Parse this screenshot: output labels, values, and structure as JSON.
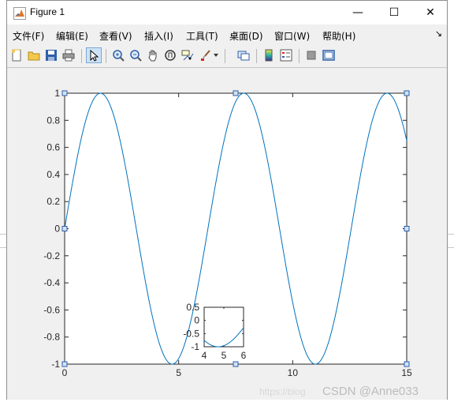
{
  "window": {
    "title": "Figure 1"
  },
  "window_controls": {
    "minimize": "—",
    "maximize": "☐",
    "close": "✕"
  },
  "menu": [
    "文件(F)",
    "编辑(E)",
    "查看(V)",
    "插入(I)",
    "工具(T)",
    "桌面(D)",
    "窗口(W)",
    "帮助(H)"
  ],
  "toolbar_icons": [
    "new-figure-icon",
    "open-file-icon",
    "save-icon",
    "print-icon",
    "edit-plot-arrow-icon",
    "zoom-in-icon",
    "zoom-out-icon",
    "pan-hand-icon",
    "rotate-3d-icon",
    "data-cursor-icon",
    "brush-icon",
    "brush-dropdown-icon",
    "link-plot-icon",
    "colorbar-icon",
    "legend-icon",
    "hide-plot-tools-icon",
    "show-plot-tools-icon"
  ],
  "watermark": "CSDN @Anne033",
  "watermark_faint": "https://blog",
  "chart_data": [
    {
      "type": "line",
      "function": "sin(x)",
      "x_range": [
        0,
        15
      ],
      "xlim": [
        0,
        15
      ],
      "ylim": [
        -1,
        1
      ],
      "xticks": [
        0,
        5,
        10,
        15
      ],
      "xtick_labels": [
        "0",
        "5",
        "10",
        "15"
      ],
      "yticks": [
        -1,
        -0.8,
        -0.6,
        -0.4,
        -0.2,
        0,
        0.2,
        0.4,
        0.6,
        0.8,
        1
      ],
      "ytick_labels": [
        "-1",
        "-0.8",
        "-0.6",
        "-0.4",
        "-0.2",
        "0",
        "0.2",
        "0.4",
        "0.6",
        "0.8",
        "1"
      ],
      "series_color": "#0072bd",
      "selected": true,
      "title": "",
      "xlabel": "",
      "ylabel": "",
      "grid": false
    },
    {
      "type": "line",
      "function": "sin(x)",
      "x_range": [
        4,
        6
      ],
      "xlim": [
        4,
        6
      ],
      "ylim": [
        -1,
        0.5
      ],
      "xticks": [
        4,
        5,
        6
      ],
      "xtick_labels": [
        "4",
        "5",
        "6"
      ],
      "yticks": [
        -1,
        -0.5,
        0,
        0.5
      ],
      "ytick_labels": [
        "-1",
        "-0.5",
        "0",
        "0.5"
      ],
      "series_color": "#0072bd",
      "title": "",
      "xlabel": "",
      "ylabel": "",
      "grid": false
    }
  ]
}
